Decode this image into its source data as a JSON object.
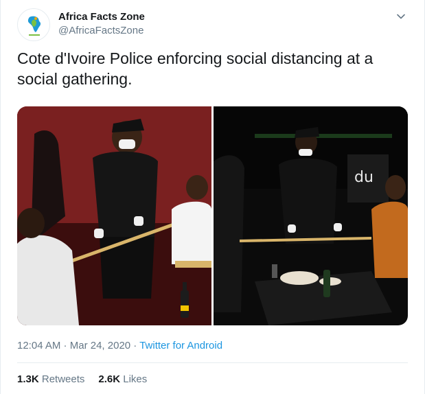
{
  "account": {
    "display_name": "Africa Facts Zone",
    "handle": "@AfricaFactsZone",
    "avatar_icon": "africa-map-logo-icon"
  },
  "menu_icon": "chevron-down-icon",
  "tweet": {
    "text": "Cote d'Ivoire Police enforcing social distancing at a social gathering."
  },
  "media": [
    {
      "alt_icon": "photo-police-indoor"
    },
    {
      "alt_icon": "photo-police-outdoor"
    }
  ],
  "meta": {
    "time": "12:04 AM",
    "separator1": " · ",
    "date": "Mar 24, 2020",
    "separator2": " · ",
    "source": "Twitter for Android"
  },
  "stats": {
    "retweets_count": "1.3K",
    "retweets_label": "Retweets",
    "likes_count": "2.6K",
    "likes_label": "Likes"
  },
  "colors": {
    "link": "#1b95e0",
    "muted": "#657786",
    "text": "#14171a"
  }
}
